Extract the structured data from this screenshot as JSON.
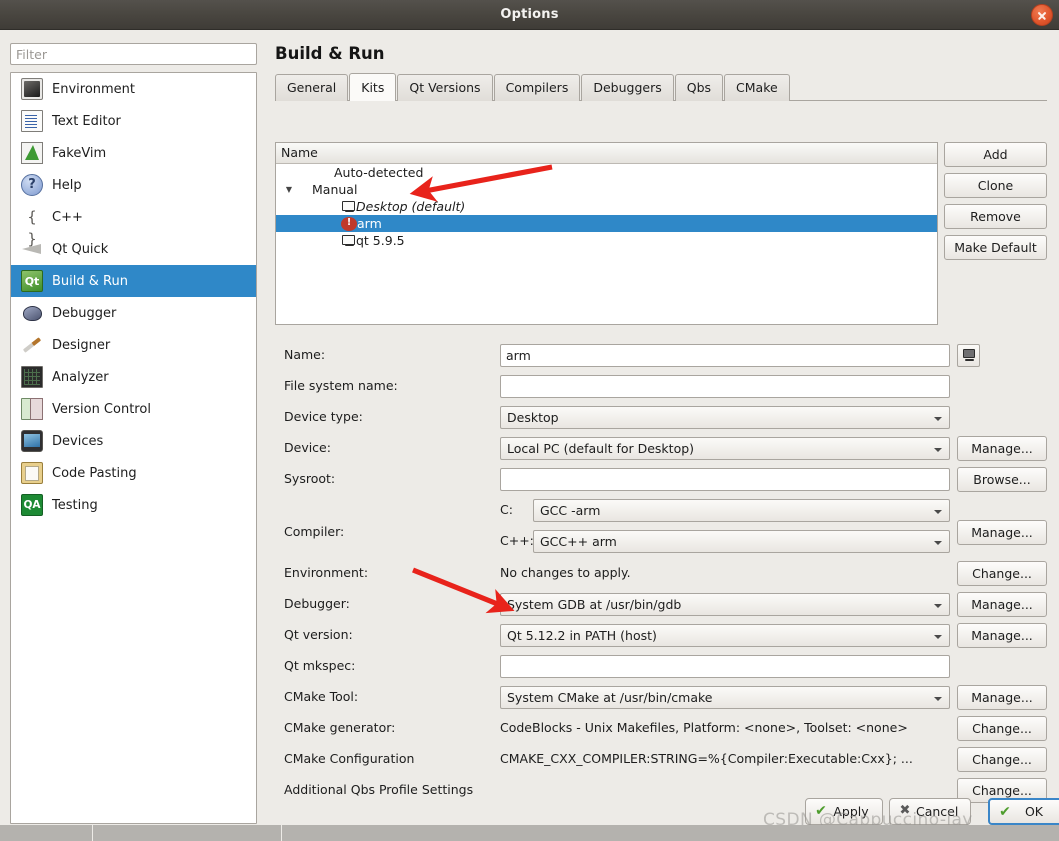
{
  "window": {
    "title": "Options",
    "close_icon": "close-icon"
  },
  "sidebar": {
    "filter_placeholder": "Filter",
    "filter_value": "",
    "items": [
      {
        "label": "Environment",
        "icon": "monitor-icon",
        "selected": false
      },
      {
        "label": "Text Editor",
        "icon": "text-document-icon",
        "selected": false
      },
      {
        "label": "FakeVim",
        "icon": "fakevim-icon",
        "selected": false
      },
      {
        "label": "Help",
        "icon": "question-mark-icon",
        "selected": false
      },
      {
        "label": "C++",
        "icon": "braces-icon",
        "selected": false
      },
      {
        "label": "Qt Quick",
        "icon": "paper-plane-icon",
        "selected": false
      },
      {
        "label": "Build & Run",
        "icon": "qt-build-icon",
        "selected": true
      },
      {
        "label": "Debugger",
        "icon": "bug-icon",
        "selected": false
      },
      {
        "label": "Designer",
        "icon": "pencil-ruler-icon",
        "selected": false
      },
      {
        "label": "Analyzer",
        "icon": "oscilloscope-icon",
        "selected": false
      },
      {
        "label": "Version Control",
        "icon": "documents-icon",
        "selected": false
      },
      {
        "label": "Devices",
        "icon": "tablet-icon",
        "selected": false
      },
      {
        "label": "Code Pasting",
        "icon": "clipboard-globe-icon",
        "selected": false
      },
      {
        "label": "Testing",
        "icon": "qa-badge-icon",
        "selected": false
      }
    ]
  },
  "page": {
    "title": "Build & Run",
    "tabs": [
      {
        "label": "General",
        "active": false
      },
      {
        "label": "Kits",
        "active": true
      },
      {
        "label": "Qt Versions",
        "active": false
      },
      {
        "label": "Compilers",
        "active": false
      },
      {
        "label": "Debuggers",
        "active": false
      },
      {
        "label": "Qbs",
        "active": false
      },
      {
        "label": "CMake",
        "active": false
      }
    ]
  },
  "kit_tree": {
    "column_header": "Name",
    "rows": [
      {
        "label": "Auto-detected",
        "indent": 1,
        "icon": "none",
        "twisty": "",
        "selected": false,
        "italic": false
      },
      {
        "label": "Manual",
        "indent": 0,
        "icon": "none",
        "twisty": "▼",
        "selected": false,
        "italic": false
      },
      {
        "label": "Desktop (default)",
        "indent": 2,
        "icon": "monitor-icon",
        "twisty": "",
        "selected": false,
        "italic": true
      },
      {
        "label": "arm",
        "indent": 2,
        "icon": "warning-icon",
        "twisty": "",
        "selected": true,
        "italic": false
      },
      {
        "label": "qt 5.9.5",
        "indent": 2,
        "icon": "monitor-icon",
        "twisty": "",
        "selected": false,
        "italic": false
      }
    ]
  },
  "tree_buttons": [
    {
      "label": "Add"
    },
    {
      "label": "Clone"
    },
    {
      "label": "Remove"
    },
    {
      "label": "Make Default"
    }
  ],
  "form": {
    "name": {
      "label": "Name:",
      "value": "arm",
      "device_button_icon": "monitor-icon"
    },
    "file_system_name": {
      "label": "File system name:",
      "value": ""
    },
    "device_type": {
      "label": "Device type:",
      "value": "Desktop"
    },
    "device": {
      "label": "Device:",
      "value": "Local PC (default for Desktop)",
      "button": "Manage..."
    },
    "sysroot": {
      "label": "Sysroot:",
      "value": "",
      "button": "Browse..."
    },
    "compiler": {
      "label": "Compiler:",
      "c_prefix": "C:",
      "c_value": "GCC -arm",
      "cxx_prefix": "C++:",
      "cxx_value": "GCC++ arm",
      "button": "Manage..."
    },
    "environment": {
      "label": "Environment:",
      "value": "No changes to apply.",
      "button": "Change..."
    },
    "debugger": {
      "label": "Debugger:",
      "value": "System GDB at /usr/bin/gdb",
      "button": "Manage..."
    },
    "qt_version": {
      "label": "Qt version:",
      "value": "Qt 5.12.2 in PATH (host)",
      "button": "Manage..."
    },
    "qt_mkspec": {
      "label": "Qt mkspec:",
      "value": ""
    },
    "cmake_tool": {
      "label": "CMake Tool:",
      "value": "System CMake at /usr/bin/cmake",
      "button": "Manage..."
    },
    "cmake_generator": {
      "label": "CMake generator:",
      "value": "CodeBlocks - Unix Makefiles, Platform: <none>, Toolset: <none>",
      "button": "Change..."
    },
    "cmake_configuration": {
      "label": "CMake Configuration",
      "value": "CMAKE_CXX_COMPILER:STRING=%{Compiler:Executable:Cxx}; ...",
      "button": "Change..."
    },
    "additional_qbs": {
      "label": "Additional Qbs Profile Settings",
      "value": "",
      "button": "Change..."
    }
  },
  "dialog_buttons": [
    {
      "label": "Apply",
      "icon": "check-icon",
      "default": false
    },
    {
      "label": "Cancel",
      "icon": "x-icon",
      "default": false
    },
    {
      "label": "OK",
      "icon": "check-icon",
      "default": true
    }
  ],
  "annotations": {
    "arrow_color": "#e8231b",
    "arrow_targets": [
      "arm-kit-row",
      "qt-version-combo"
    ]
  },
  "watermark": {
    "text": "CSDN @Cappuccino-jay"
  },
  "colors": {
    "selection_blue": "#2f88c8",
    "titlebar_dark": "#48453f",
    "window_bg": "#edebe7",
    "close_red": "#e0562c",
    "warning_red": "#c0392b"
  }
}
